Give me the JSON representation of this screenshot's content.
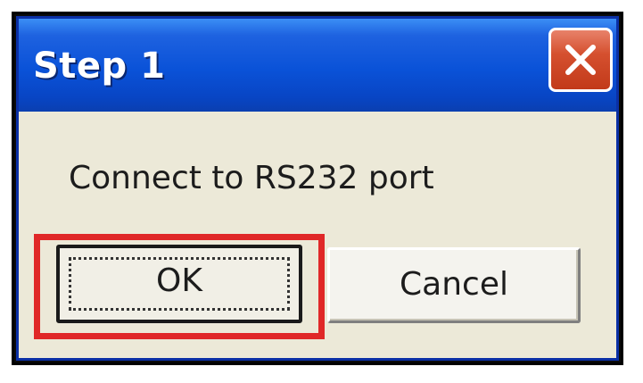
{
  "dialog": {
    "title": "Step 1",
    "message": "Connect to RS232 port",
    "close_icon": "close-icon"
  },
  "buttons": {
    "ok_label": "OK",
    "cancel_label": "Cancel"
  },
  "colors": {
    "titlebar": "#0a52d8",
    "close_button": "#d5502f",
    "dialog_background": "#ece9d8",
    "highlight": "#e02828"
  }
}
